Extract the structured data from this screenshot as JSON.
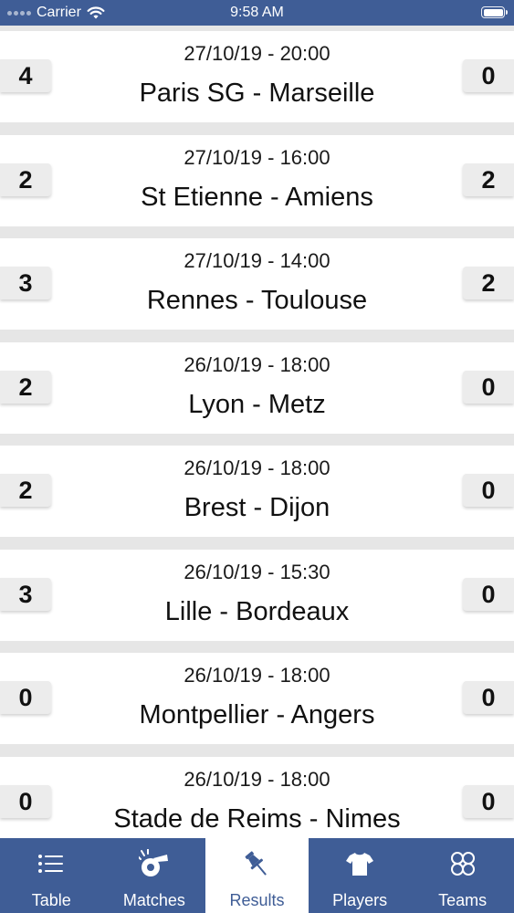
{
  "status_bar": {
    "carrier": "Carrier",
    "time": "9:58 AM"
  },
  "matches": [
    {
      "date": "27/10/19 - 20:00",
      "teams": "Paris SG - Marseille",
      "home_score": "4",
      "away_score": "0"
    },
    {
      "date": "27/10/19 - 16:00",
      "teams": "St Etienne - Amiens",
      "home_score": "2",
      "away_score": "2"
    },
    {
      "date": "27/10/19 - 14:00",
      "teams": "Rennes - Toulouse",
      "home_score": "3",
      "away_score": "2"
    },
    {
      "date": "26/10/19 - 18:00",
      "teams": "Lyon - Metz",
      "home_score": "2",
      "away_score": "0"
    },
    {
      "date": "26/10/19 - 18:00",
      "teams": "Brest - Dijon",
      "home_score": "2",
      "away_score": "0"
    },
    {
      "date": "26/10/19 - 15:30",
      "teams": "Lille - Bordeaux",
      "home_score": "3",
      "away_score": "0"
    },
    {
      "date": "26/10/19 - 18:00",
      "teams": "Montpellier - Angers",
      "home_score": "0",
      "away_score": "0"
    },
    {
      "date": "26/10/19 - 18:00",
      "teams": "Stade de Reims - Nimes",
      "home_score": "0",
      "away_score": "0"
    }
  ],
  "tabs": [
    {
      "label": "Table",
      "icon": "list-icon",
      "active": false
    },
    {
      "label": "Matches",
      "icon": "whistle-icon",
      "active": false
    },
    {
      "label": "Results",
      "icon": "pushpin-icon",
      "active": true
    },
    {
      "label": "Players",
      "icon": "jersey-icon",
      "active": false
    },
    {
      "label": "Teams",
      "icon": "teams-icon",
      "active": false
    }
  ],
  "colors": {
    "brand_blue": "#3f5d96",
    "background": "#e6e6e6",
    "card": "#ffffff",
    "score_box": "#ececec"
  }
}
